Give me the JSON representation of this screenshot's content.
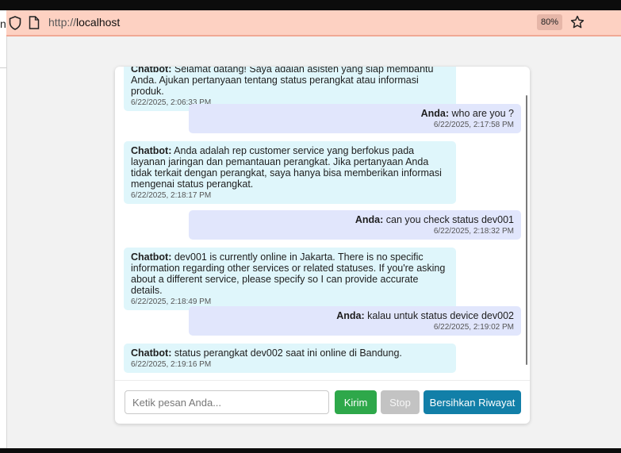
{
  "browser": {
    "left_fragment": "n",
    "url_prefix": "http://",
    "url_host": "localhost",
    "zoom": "80%",
    "colors": {
      "toolbar": "#fdd1c2",
      "zoom_badge": "#e6b6a8"
    }
  },
  "chat": {
    "messages": [
      {
        "role": "bot",
        "sender": "Chatbot:",
        "text": "Selamat datang! Saya adalah asisten yang siap membantu Anda. Ajukan pertanyaan tentang status perangkat atau informasi produk.",
        "time": "6/22/2025, 2:06:33 PM"
      },
      {
        "role": "user",
        "sender": "Anda:",
        "text": "who are you ?",
        "time": "6/22/2025, 2:17:58 PM"
      },
      {
        "role": "bot",
        "sender": "Chatbot:",
        "text": "Anda adalah rep customer service yang berfokus pada layanan jaringan dan pemantauan perangkat. Jika pertanyaan Anda tidak terkait dengan perangkat, saya hanya bisa memberikan informasi mengenai status perangkat.",
        "time": "6/22/2025, 2:18:17 PM"
      },
      {
        "role": "user",
        "sender": "Anda:",
        "text": "can you check status dev001",
        "time": "6/22/2025, 2:18:32 PM"
      },
      {
        "role": "bot",
        "sender": "Chatbot:",
        "text": "dev001 is currently online in Jakarta. There is no specific information regarding other services or related statuses. If you're asking about a different service, please specify so I can provide accurate details.",
        "time": "6/22/2025, 2:18:49 PM"
      },
      {
        "role": "user",
        "sender": "Anda:",
        "text": "kalau untuk status device dev002",
        "time": "6/22/2025, 2:19:02 PM"
      },
      {
        "role": "bot",
        "sender": "Chatbot:",
        "text": "status perangkat dev002 saat ini online di Bandung.",
        "time": "6/22/2025, 2:19:16 PM"
      }
    ],
    "input_placeholder": "Ketik pesan Anda...",
    "buttons": {
      "send": "Kirim",
      "stop": "Stop",
      "clear": "Bersihkan Riwayat"
    },
    "colors": {
      "bot_bubble": "#dff6fb",
      "user_bubble": "#e1e6fc",
      "send": "#2ea84a",
      "stop": "#c3c3c3",
      "clear": "#127fa8"
    }
  }
}
